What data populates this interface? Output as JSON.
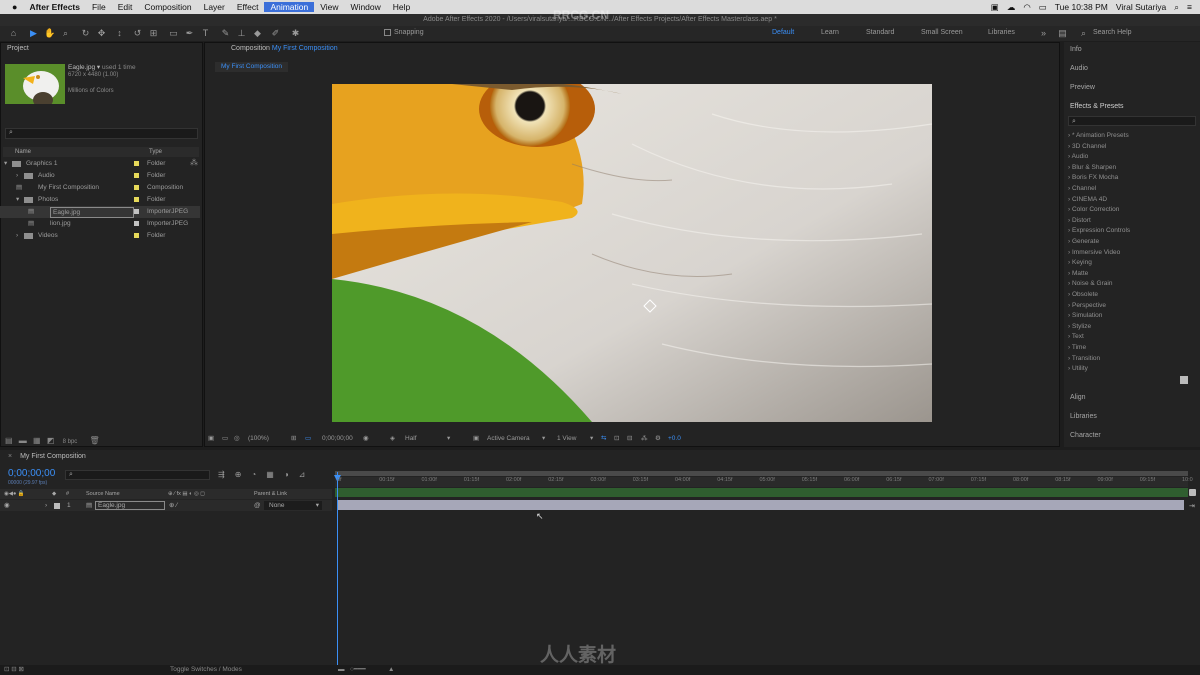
{
  "menubar": {
    "apple": "",
    "app": "After Effects",
    "items": [
      "File",
      "Edit",
      "Composition",
      "Layer",
      "Effect",
      "Animation",
      "View",
      "Window",
      "Help"
    ],
    "clock": "Tue 10:38 PM",
    "user": "Viral Sutariya"
  },
  "window_title": "Adobe After Effects 2020 - /Users/viralsutariya/...RBCG.CN.../After Effects Projects/After Effects Masterclass.aep *",
  "toolbar": {
    "snapping": "Snapping",
    "workspaces": [
      "Default",
      "Learn",
      "Standard",
      "Small Screen",
      "Libraries"
    ],
    "active_workspace": "Default",
    "search_help": "Search Help"
  },
  "project": {
    "title": "Project",
    "asset_name": "Eagle.jpg",
    "asset_used": "used 1 time",
    "asset_dims": "6720 x 4480 (1.00)",
    "asset_colors": "Millions of Colors",
    "col_name": "Name",
    "col_type": "Type",
    "items": [
      {
        "name": "Graphics 1",
        "type": "Folder",
        "color": "#e6d95a",
        "indent": 0
      },
      {
        "name": "Audio",
        "type": "Folder",
        "color": "#e6d95a",
        "indent": 1
      },
      {
        "name": "My First Composition",
        "type": "Composition",
        "color": "#e6d95a",
        "indent": 1
      },
      {
        "name": "Photos",
        "type": "Folder",
        "color": "#e6d95a",
        "indent": 1
      },
      {
        "name": "Eagle.jpg",
        "type": "ImporterJPEG",
        "color": "#c2c2c2",
        "indent": 2
      },
      {
        "name": "lion.jpg",
        "type": "ImporterJPEG",
        "color": "#c2c2c2",
        "indent": 2
      },
      {
        "name": "Videos",
        "type": "Folder",
        "color": "#e6d95a",
        "indent": 1
      }
    ],
    "bpc": "8 bpc"
  },
  "composition": {
    "panel_label": "Composition",
    "comp_name": "My First Composition",
    "tab": "My First Composition",
    "zoom": "(100%)",
    "timecode": "0;00;00;00",
    "resolution": "Half",
    "camera": "Active Camera",
    "views": "1 View",
    "exposure": "+0.0"
  },
  "right_panels": {
    "top": [
      "Info",
      "Audio",
      "Preview"
    ],
    "effects_title": "Effects & Presets",
    "effects": [
      "* Animation Presets",
      "3D Channel",
      "Audio",
      "Blur & Sharpen",
      "Boris FX Mocha",
      "Channel",
      "CINEMA 4D",
      "Color Correction",
      "Distort",
      "Expression Controls",
      "Generate",
      "Immersive Video",
      "Keying",
      "Matte",
      "Noise & Grain",
      "Obsolete",
      "Perspective",
      "Simulation",
      "Stylize",
      "Text",
      "Time",
      "Transition",
      "Utility"
    ],
    "bottom": [
      "Align",
      "Libraries",
      "Character"
    ]
  },
  "timeline": {
    "comp_name": "My First Composition",
    "timecode": "0;00;00;00",
    "fps": "00000 (29.97 fps)",
    "col_source": "Source Name",
    "col_parent": "Parent & Link",
    "layer_num": "1",
    "layer_name": "Eagle.jpg",
    "layer_parent": "None",
    "ticks": [
      "0f",
      "00:15f",
      "01:00f",
      "01:15f",
      "02:00f",
      "02:15f",
      "03:00f",
      "03:15f",
      "04:00f",
      "04:15f",
      "05:00f",
      "05:15f",
      "06:00f",
      "06:15f",
      "07:00f",
      "07:15f",
      "08:00f",
      "08:15f",
      "09:00f",
      "09:15f",
      "10:0"
    ],
    "toggle": "Toggle Switches / Modes"
  },
  "watermark": "人人素材",
  "watermark_top": "RRCG.CN"
}
